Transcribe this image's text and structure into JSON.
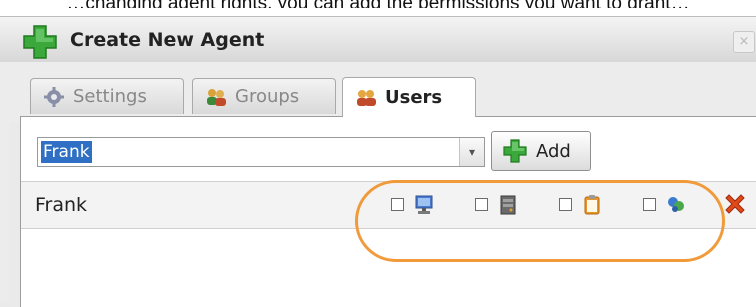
{
  "caption": "…changing agent rights, you can add the permissions you want to grant…",
  "dialog": {
    "title": "Create New Agent",
    "close_glyph": "×",
    "title_icon": "green-plus-icon"
  },
  "tabs": [
    {
      "label": "Settings",
      "icon": "gear-icon"
    },
    {
      "label": "Groups",
      "icon": "groups-icon"
    },
    {
      "label": "Users",
      "icon": "users-icon",
      "active": true
    }
  ],
  "user_select": {
    "value": "Frank",
    "dropdown_glyph": "▾"
  },
  "add_button": {
    "label": "Add",
    "icon": "green-plus-icon"
  },
  "user_row": {
    "name": "Frank",
    "permissions": [
      {
        "icon": "monitor-icon",
        "checked": false
      },
      {
        "icon": "server-icon",
        "checked": false
      },
      {
        "icon": "clipboard-icon",
        "checked": false
      },
      {
        "icon": "network-users-icon",
        "checked": false
      }
    ],
    "delete_icon": "red-x-icon"
  },
  "colors": {
    "accent": "#2f6fc4",
    "highlight": "#f09a3a",
    "plus_green": "#3aa83a",
    "delete_red": "#e04a1a"
  }
}
